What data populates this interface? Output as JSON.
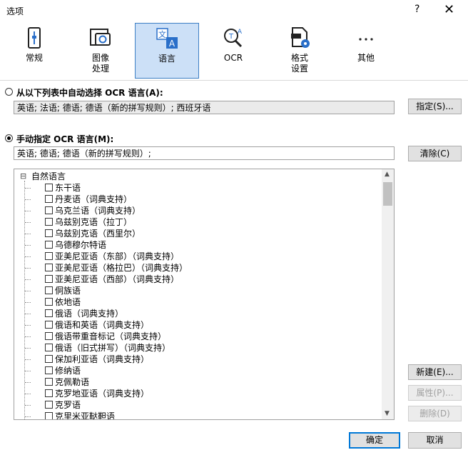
{
  "window": {
    "title": "选项",
    "help_glyph": "?",
    "close_glyph": "✕"
  },
  "toolbar": {
    "tabs": [
      {
        "label": "常规",
        "icon": "settings-phone-icon"
      },
      {
        "label": "图像\n处理",
        "icon": "image-camera-icon"
      },
      {
        "label": "语言",
        "icon": "language-translate-icon",
        "selected": true
      },
      {
        "label": "OCR",
        "icon": "ocr-magnifier-icon"
      },
      {
        "label": "格式\n设置",
        "icon": "format-settings-icon"
      },
      {
        "label": "其他",
        "icon": "more-dots-icon"
      }
    ]
  },
  "auto": {
    "label": "从以下列表中自动选择 OCR 语言(A):",
    "value": "英语; 法语; 德语; 德语（新的拼写规则）; 西班牙语",
    "button": "指定(S)..."
  },
  "manual": {
    "label": "手动指定 OCR 语言(M):",
    "value": "英语; 德语; 德语（新的拼写规则）;",
    "button": "清除(C)"
  },
  "tree": {
    "root": "自然语言",
    "root_toggle": "⊟",
    "items": [
      "东干语",
      "丹麦语（词典支持）",
      "乌克兰语（词典支持）",
      "乌兹别克语（拉丁）",
      "乌兹别克语（西里尔）",
      "乌德穆尔特语",
      "亚美尼亚语（东部）（词典支持）",
      "亚美尼亚语（格拉巴）（词典支持）",
      "亚美尼亚语（西部）（词典支持）",
      "侗族语",
      "依地语",
      "俄语（词典支持）",
      "俄语和英语（词典支持）",
      "俄语带重音标记（词典支持）",
      "俄语（旧式拼写）（词典支持）",
      "保加利亚语（词典支持）",
      "修纳语",
      "克佩勒语",
      "克罗地亚语（词典支持）",
      "克罗语",
      "克里米亚鞑靼语"
    ]
  },
  "side_buttons": {
    "new": "新建(E)...",
    "properties": "属性(P)...",
    "delete": "删除(D)"
  },
  "footer": {
    "ok": "确定",
    "cancel": "取消"
  }
}
